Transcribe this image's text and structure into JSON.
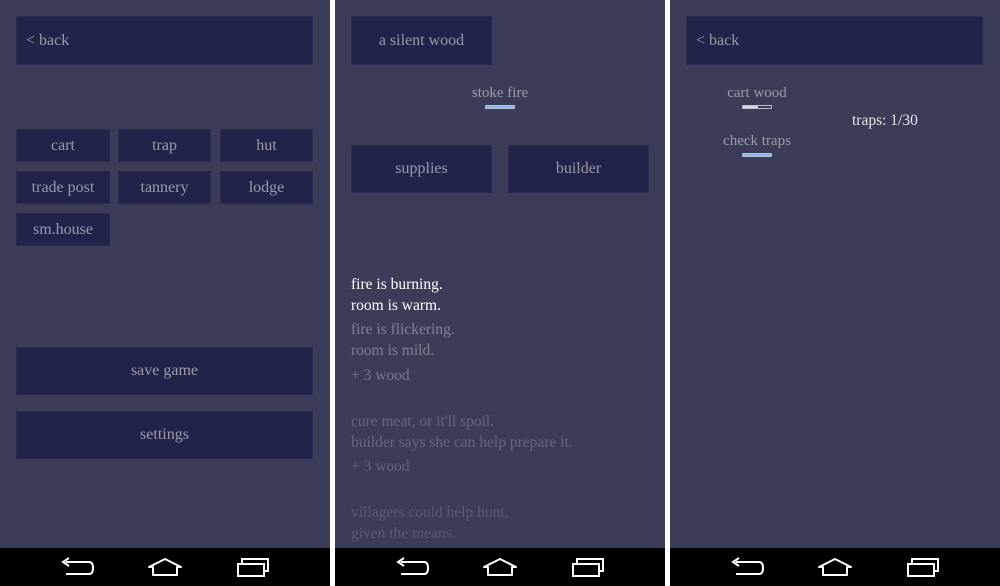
{
  "colors": {
    "background": "#3a3c58",
    "button_bg": "#212449",
    "button_text": "#9a9aab",
    "progress_fill_active": "#8fb4e8",
    "progress_fill_partial": "#d8d8e0",
    "navbar_bg": "#000000",
    "divider": "#ffffff"
  },
  "screen_build": {
    "back_label": "< back",
    "build_buttons": [
      {
        "label": "cart"
      },
      {
        "label": "trap"
      },
      {
        "label": "hut"
      },
      {
        "label": "trade post"
      },
      {
        "label": "tannery"
      },
      {
        "label": "lodge"
      },
      {
        "label": "sm.house"
      }
    ],
    "save_label": "save game",
    "settings_label": "settings"
  },
  "screen_room": {
    "location_button": "a silent wood",
    "stoke_fire": {
      "label": "stoke fire",
      "progress": 1.0
    },
    "supplies_label": "supplies",
    "builder_label": "builder",
    "messages": [
      {
        "text": "fire is burning.",
        "opacity": 1.0
      },
      {
        "text": "room is warm.",
        "opacity": 1.0
      },
      {
        "text": "fire is flickering.",
        "opacity": 0.35
      },
      {
        "text": "room is mild.",
        "opacity": 0.35
      },
      {
        "text": "+ 3 wood",
        "opacity": 0.3
      },
      {
        "text": "cure meat, or it'll spoil.",
        "opacity": 0.22
      },
      {
        "text": "builder says she can help prepare it.",
        "opacity": 0.22
      },
      {
        "text": "+ 3 wood",
        "opacity": 0.2
      },
      {
        "text": "villagers could help hunt,",
        "opacity": 0.16
      },
      {
        "text": "given the means.",
        "opacity": 0.16
      }
    ]
  },
  "screen_forest": {
    "back_label": "< back",
    "cart_wood": {
      "label": "cart wood",
      "progress": 0.55
    },
    "check_traps": {
      "label": "check traps",
      "progress": 1.0
    },
    "traps_label": "traps: 1/30"
  },
  "navbar": {
    "icons": [
      "back-icon",
      "home-icon",
      "recent-apps-icon"
    ]
  }
}
